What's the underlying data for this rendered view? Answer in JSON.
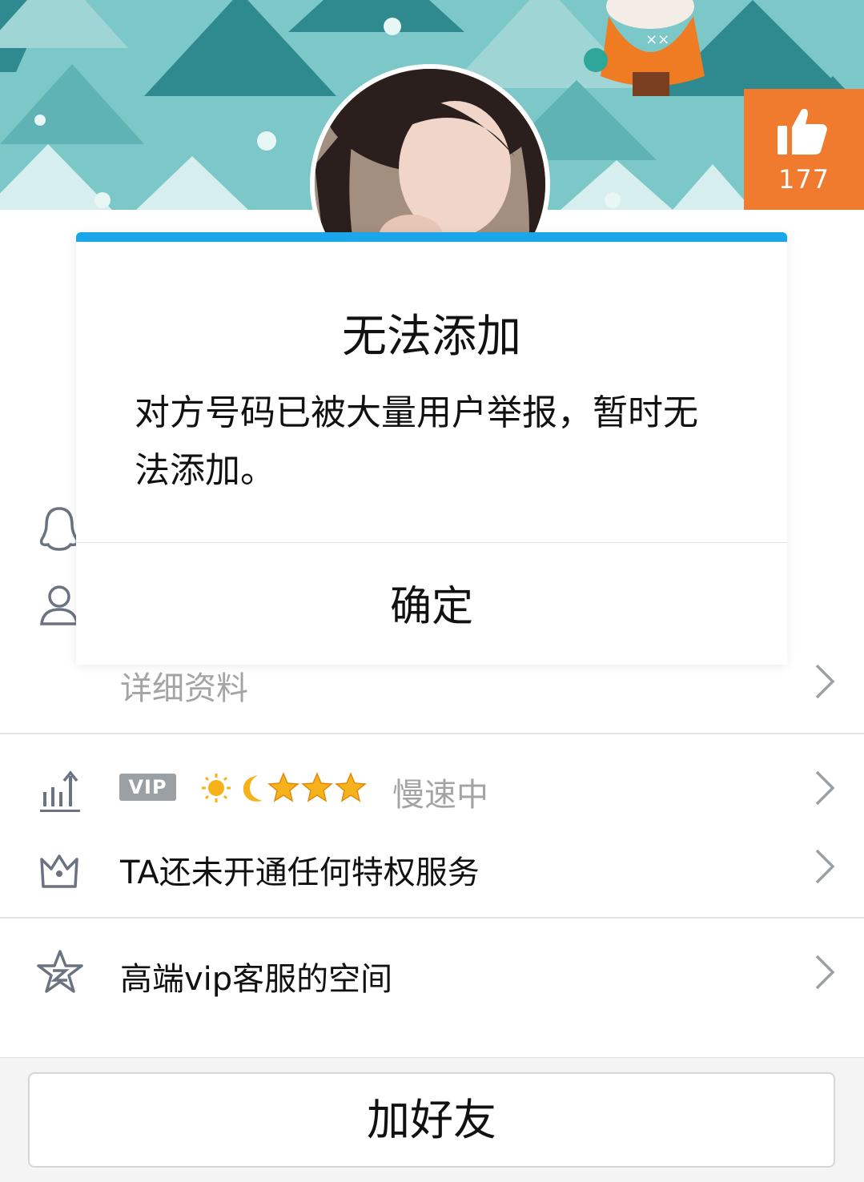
{
  "header": {
    "like_count": "177"
  },
  "profile_rows": {
    "details_label": "详细资料",
    "vip_badge": "VIP",
    "vip_status": "慢速中",
    "privilege_text": "TA还未开通任何特权服务",
    "space_text": "高端vip客服的空间"
  },
  "dialog": {
    "title": "无法添加",
    "message": "对方号码已被大量用户举报，暂时无法添加。",
    "confirm_label": "确定"
  },
  "bottom": {
    "add_friend_label": "加好友"
  },
  "colors": {
    "banner": "#74c2c4",
    "like": "#f07a2e",
    "dialog_accent": "#1aa6e8"
  }
}
